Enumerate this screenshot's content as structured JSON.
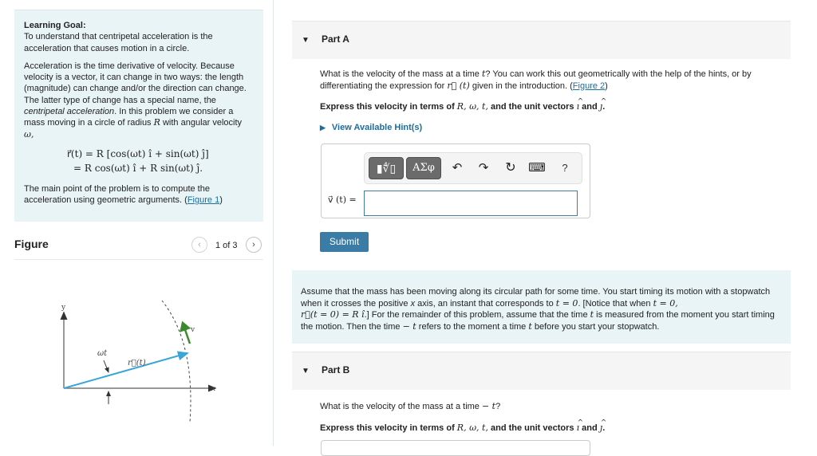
{
  "intro": {
    "goal_title": "Learning Goal:",
    "goal_text": "To understand that centripetal acceleration is the acceleration that causes motion in a circle.",
    "para1_a": "Acceleration is the time derivative of velocity. Because velocity is a vector, it can change in two ways: the length (magnitude) can change and/or the direction can change. The latter type of change has a special name, the ",
    "para1_em": "centripetal acceleration",
    "para1_b": ". In this problem we consider a mass moving in a circle of radius ",
    "para1_R": "R",
    "para1_c": " with angular velocity ",
    "para1_omega": "ω,",
    "eq_line1": "r⃗(t) = R [cos(ωt) î + sin(ωt) ĵ]",
    "eq_line2": "= R cos(ωt) î + R sin(ωt) ĵ.",
    "para2": "The main point of the problem is to compute the acceleration using geometric arguments. (",
    "para2_link": "Figure 1",
    "para2_end": ")"
  },
  "figure": {
    "title": "Figure",
    "count": "1 of 3",
    "prev_icon": "‹",
    "next_icon": "›",
    "labels": {
      "y": "y",
      "x": "x",
      "v": "v",
      "omega_t": "ωt",
      "r_t": "r⃗(t)"
    },
    "colors": {
      "radius": "#3aa6d8",
      "velocity": "#3c8a2e",
      "axes": "#444444"
    }
  },
  "partA": {
    "title": "Part A",
    "question_a": "What is the velocity of the mass at a time ",
    "question_t": "t",
    "question_b": "? You can work this out geometrically with the help of the hints, or by differentiating the expression for ",
    "question_r": "r⃗ (t)",
    "question_c": " given in the introduction. (",
    "question_link": "Figure 2",
    "question_end": ")",
    "express_a": "Express this velocity in terms of ",
    "express_vars": "R, ω, t,",
    "express_b": " and the unit vectors ",
    "express_i": "ı",
    "express_and": " and ",
    "express_j": "ȷ",
    "express_end": ".",
    "hints_label": "View Available Hint(s)",
    "answer_label": "v⃗ (t) =",
    "answer_value": "",
    "submit_label": "Submit"
  },
  "toolbar": {
    "templates_label": "▮∜▯",
    "greek_label": "ΑΣφ",
    "undo_icon": "↶",
    "redo_icon": "↷",
    "reset_icon": "↻",
    "keyboard_icon": "⌨",
    "help_label": "?"
  },
  "assume": {
    "text_a": "Assume that the mass has been moving along its circular path for some time. You start timing its motion with a stopwatch when it crosses the positive ",
    "text_x": "x",
    "text_b": " axis, an instant that corresponds to ",
    "text_t0": "t = 0",
    "text_c": ". [Notice that when ",
    "text_t0b": "t = 0,",
    "text_r0": "r⃗(t = 0) = R î",
    "text_d": ".] For the remainder of this problem, assume that the time ",
    "text_t": "t",
    "text_e": " is measured from the moment you start timing the motion. Then the time ",
    "text_mt": "− t",
    "text_f": " refers to the moment a time ",
    "text_t2": "t",
    "text_g": " before you start your stopwatch."
  },
  "partB": {
    "title": "Part B",
    "question_a": "What is the velocity of the mass at a time ",
    "question_mt": "− t",
    "question_end": "?",
    "express_a": "Express this velocity in terms of ",
    "express_vars": "R, ω, t,",
    "express_b": " and the unit vectors ",
    "express_i": "ı",
    "express_and": " and ",
    "express_j": "ȷ",
    "express_end": "."
  },
  "colors": {
    "accent": "#3a7ca5",
    "link": "#1a6ea0",
    "info_bg": "#e9f4f6",
    "part_bg": "#f5f5f5"
  }
}
